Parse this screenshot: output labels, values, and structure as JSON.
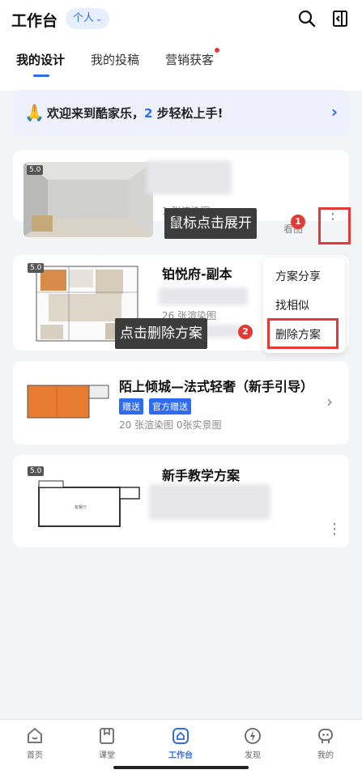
{
  "header": {
    "title": "工作台",
    "scope_label": "个人",
    "scope_chevron": "⌄",
    "search_icon": "search-icon",
    "exit_icon": "exit-icon"
  },
  "tabs": [
    {
      "label": "我的设计",
      "active": true
    },
    {
      "label": "我的投稿",
      "active": false
    },
    {
      "label": "营销获客",
      "active": false,
      "has_dot": true
    }
  ],
  "banner": {
    "emoji": "🙏",
    "text_before": "欢迎来到酷家乐，",
    "number": "2",
    "text_after": " 步轻松上手!",
    "arrow": "›"
  },
  "designs": [
    {
      "badge": "5.0",
      "title": "",
      "meta": "1 张渲染图",
      "extra": "看图"
    },
    {
      "badge": "5.0",
      "title": "铂悦府-副本",
      "meta": "26 张渲染图"
    },
    {
      "badge": "",
      "title": "陌上倾城—法式轻奢（新手引导）",
      "tags": [
        "赠送",
        "官方赠送"
      ],
      "meta": "20 张渲染图  0张实景图",
      "arrow": "›"
    },
    {
      "badge": "5.0",
      "title": "新手教学方案",
      "meta": ""
    }
  ],
  "context_menu": {
    "items": [
      "方案分享",
      "找相似",
      "删除方案"
    ]
  },
  "annotations": [
    {
      "text": "鼠标点击展开",
      "step": "1"
    },
    {
      "text": "点击删除方案",
      "step": "2"
    }
  ],
  "more_glyph": "⋮",
  "bottom_nav": [
    {
      "label": "首页",
      "icon": "home-face-icon",
      "active": false
    },
    {
      "label": "课堂",
      "icon": "classroom-icon",
      "active": false
    },
    {
      "label": "工作台",
      "icon": "workbench-icon",
      "active": true
    },
    {
      "label": "发现",
      "icon": "discover-icon",
      "active": false
    },
    {
      "label": "我的",
      "icon": "profile-icon",
      "active": false
    }
  ],
  "colors": {
    "accent": "#2f6bf0",
    "annotation_red": "#e53935",
    "tooltip_bg": "#3c3c3c"
  }
}
